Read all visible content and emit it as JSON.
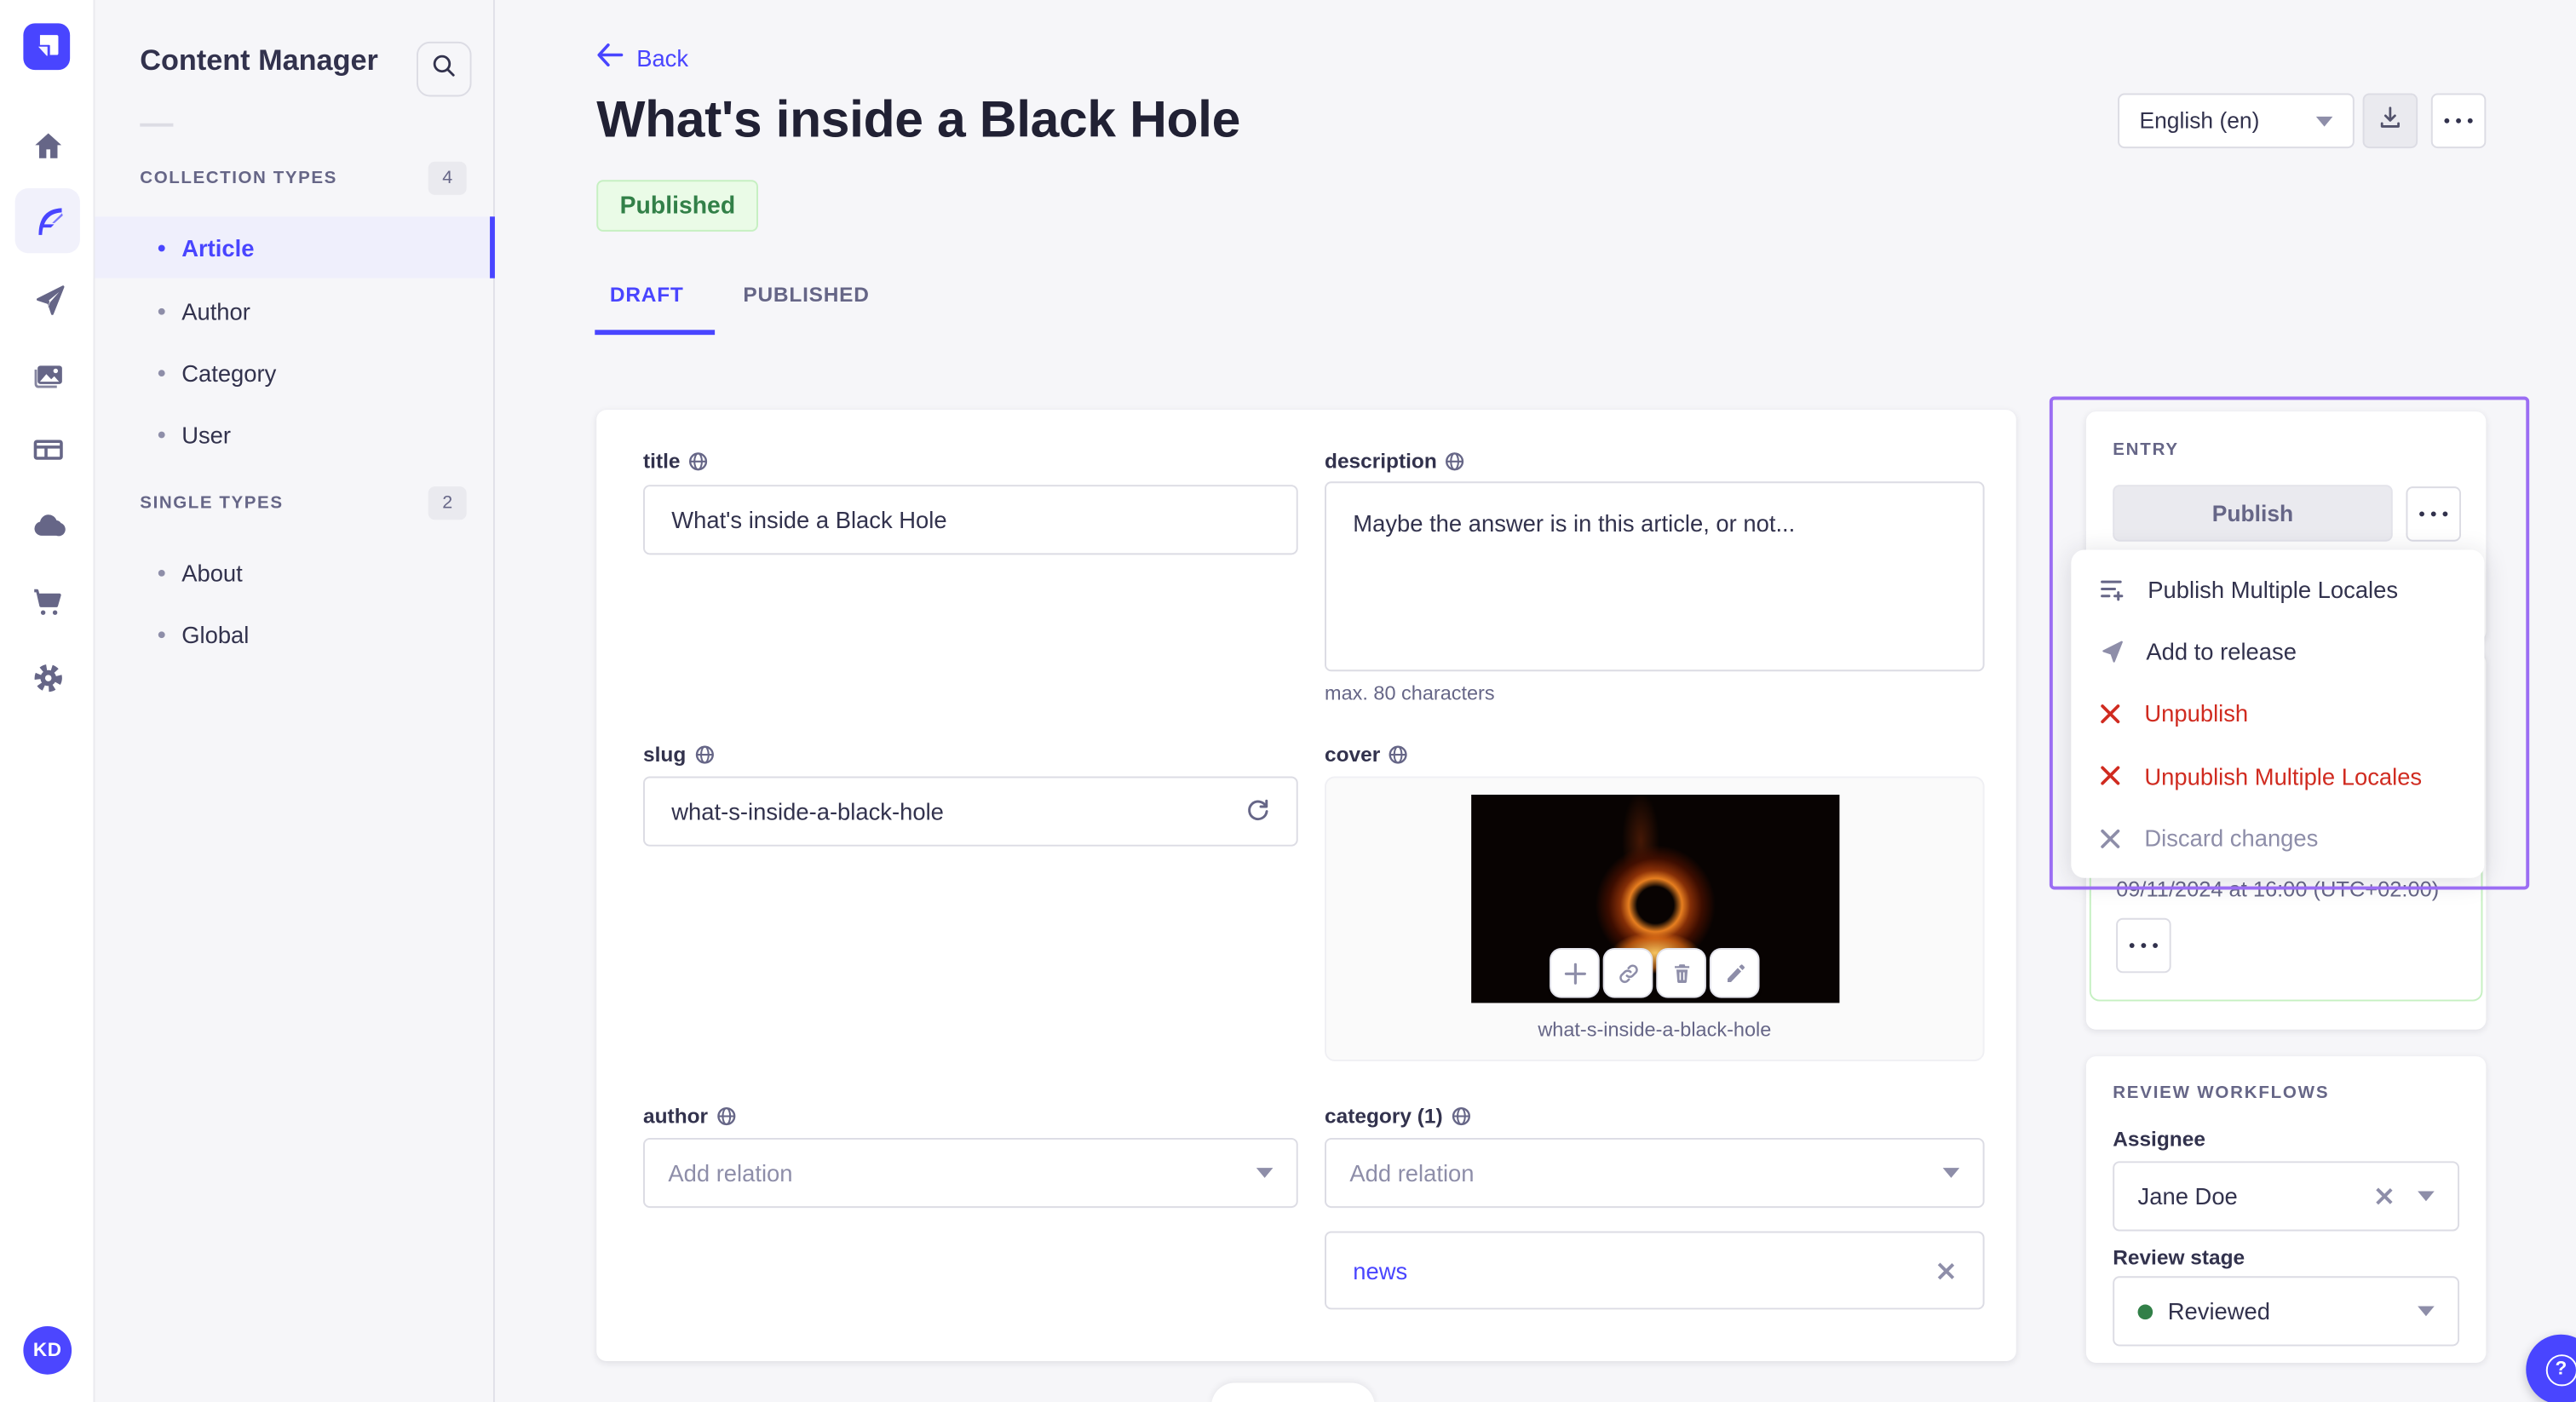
{
  "app": {
    "rail_icons": [
      "home",
      "content-manager",
      "releases",
      "media-library",
      "content-type-builder",
      "cloud",
      "marketplace",
      "settings"
    ],
    "avatar_initials": "KD",
    "help_label": "?"
  },
  "sidebar": {
    "title": "Content Manager",
    "sections": [
      {
        "label": "COLLECTION TYPES",
        "count": "4",
        "items": [
          {
            "label": "Article"
          },
          {
            "label": "Author"
          },
          {
            "label": "Category"
          },
          {
            "label": "User"
          }
        ]
      },
      {
        "label": "SINGLE TYPES",
        "count": "2",
        "items": [
          {
            "label": "About"
          },
          {
            "label": "Global"
          }
        ]
      }
    ]
  },
  "header": {
    "back_label": "Back",
    "title": "What's inside a Black Hole",
    "status": "Published",
    "locale": "English (en)"
  },
  "tabs": {
    "draft": "DRAFT",
    "published": "PUBLISHED"
  },
  "form": {
    "title": {
      "label": "title",
      "value": "What's inside a Black Hole"
    },
    "description": {
      "label": "description",
      "value": "Maybe the answer is in this article, or not...",
      "helper": "max. 80 characters"
    },
    "slug": {
      "label": "slug",
      "value": "what-s-inside-a-black-hole"
    },
    "cover": {
      "label": "cover",
      "filename": "what-s-inside-a-black-hole"
    },
    "author": {
      "label": "author",
      "placeholder": "Add relation"
    },
    "category": {
      "label": "category (1)",
      "placeholder": "Add relation",
      "tags": [
        "news"
      ]
    }
  },
  "entry_panel": {
    "title": "ENTRY",
    "publish_label": "Publish",
    "menu": [
      {
        "label": "Publish Multiple Locales",
        "type": "default",
        "icon": "list-plus-icon"
      },
      {
        "label": "Add to release",
        "type": "default",
        "icon": "paper-plane-icon"
      },
      {
        "label": "Unpublish",
        "type": "danger",
        "icon": "cross-icon"
      },
      {
        "label": "Unpublish Multiple Locales",
        "type": "danger",
        "icon": "cross-icon"
      },
      {
        "label": "Discard changes",
        "type": "disabled",
        "icon": "cross-icon"
      }
    ],
    "scheduled_date": "09/11/2024 at 16:00 (UTC+02:00)"
  },
  "review": {
    "title": "REVIEW WORKFLOWS",
    "assignee_label": "Assignee",
    "assignee_value": "Jane Doe",
    "stage_label": "Review stage",
    "stage_value": "Reviewed"
  },
  "colors": {
    "accent": "#4945ff",
    "danger": "#d02b20",
    "success_text": "#328048",
    "success_bg": "#eafbe7",
    "success_border": "#c6f0c2",
    "annotation": "#9b6df3",
    "stage_dot": "#328048"
  }
}
